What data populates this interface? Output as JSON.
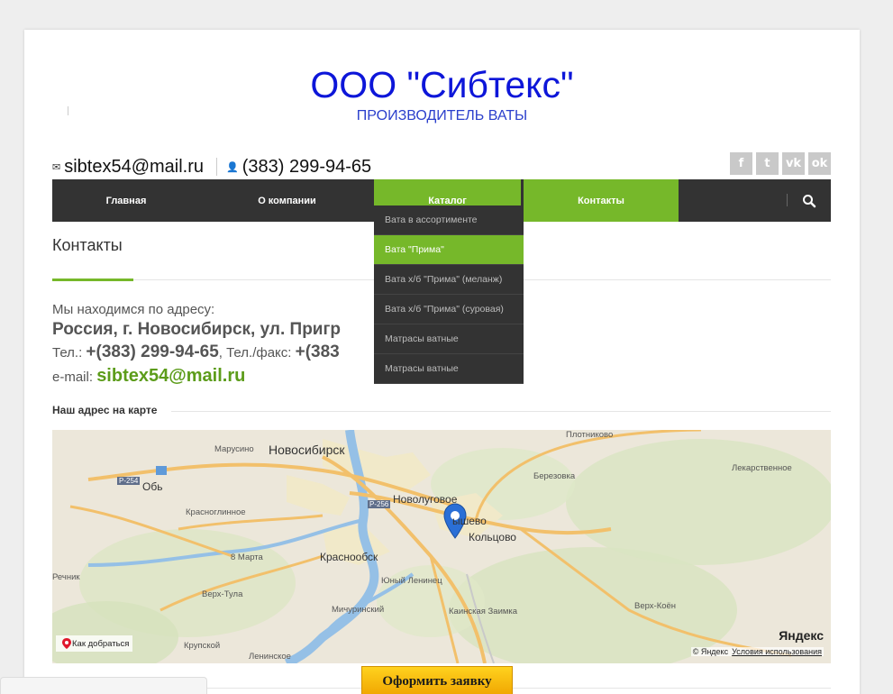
{
  "header": {
    "title": "ООО \"Сибтекс\"",
    "subtitle": "ПРОИЗВОДИТЕЛЬ ВАТЫ"
  },
  "contacts_bar": {
    "email_icon": "envelope-icon",
    "email": "sibtex54@mail.ru",
    "phone_icon": "person-icon",
    "phone": "(383) 299-94-65"
  },
  "social": [
    {
      "name": "facebook-icon",
      "glyph": "f"
    },
    {
      "name": "twitter-icon",
      "glyph": "t"
    },
    {
      "name": "vk-icon",
      "glyph": "vk"
    },
    {
      "name": "odnoklassniki-icon",
      "glyph": "ok"
    }
  ],
  "nav": {
    "items": [
      "Главная",
      "О компании",
      "Каталог",
      "Контакты"
    ],
    "accent_color": "#76b82a",
    "bg_color": "#333333",
    "search_icon": "search-icon"
  },
  "dropdown": {
    "items": [
      "Вата в ассортименте",
      "Вата \"Прима\"",
      "Вата х/б \"Прима\" (меланж)",
      "Вата х/б \"Прима\" (суровая)",
      "Матрасы ватные",
      "Матрасы ватные"
    ],
    "active_index": 1
  },
  "content": {
    "heading": "Контакты",
    "address_intro": "Мы находимся по адресу:",
    "address": "Россия, г. Новосибирск, ул. Пригр",
    "tel_label": "Тел.: ",
    "tel": "+(383) 299-94-65",
    "fax_label": ", Тел./факс: ",
    "fax": "+(383",
    "email_label": "e-mail: ",
    "email": "sibtex54@mail.ru",
    "map_title": "Наш адрес на карте"
  },
  "map": {
    "labels": [
      "Новосибирск",
      "Обь",
      "Марусино",
      "Новолуговое",
      "Кольцово",
      "Краснообск",
      "Юный Ленинец",
      "Мичуринский",
      "Каинская Заимка",
      "Плотниково",
      "Березовка",
      "Лекарственное",
      "Красноглинное",
      "8 Марта",
      "Верх-Тула",
      "Речник",
      "Крупской",
      "Ленинское",
      "Верх-Коён",
      "ышево",
      "Р-254",
      "Р-256"
    ],
    "route_button": "Как добраться",
    "logo": "Яндекс",
    "copyright": "© Яндекс",
    "terms": "Условия использования"
  },
  "order_button": "Оформить заявку"
}
